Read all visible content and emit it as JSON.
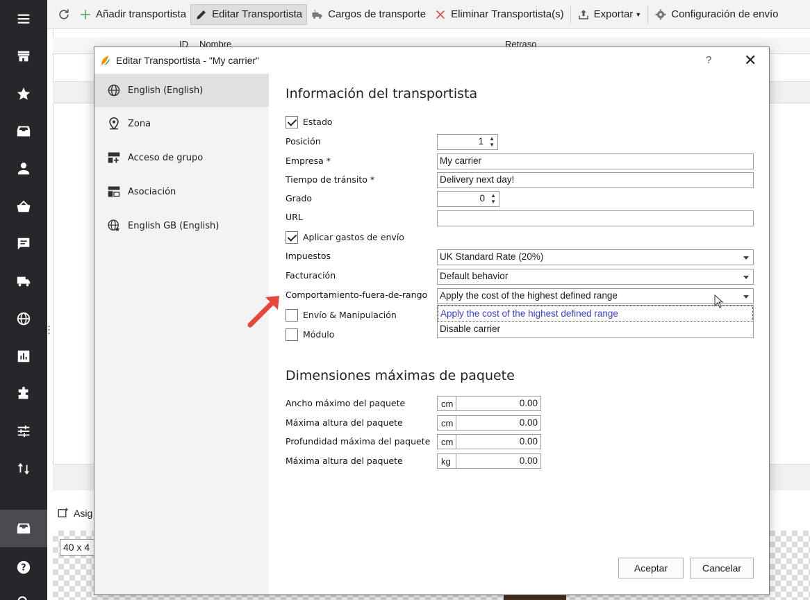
{
  "toolbar": {
    "add": "Añadir transportista",
    "edit": "Editar Transportista",
    "charges": "Cargos de transporte",
    "delete": "Eliminar Transportista(s)",
    "export": "Exportar",
    "config": "Configuración de envío"
  },
  "grid": {
    "col_id": "ID",
    "col_name": "Nombre",
    "col_delay": "Retraso",
    "assign_label": "Asig",
    "size_value": "40 x 4"
  },
  "dialog": {
    "title": "Editar Transportista - \"My carrier\"",
    "help": "?",
    "close": "✕",
    "sidebar": [
      {
        "label": "English (English)",
        "icon": "globe-icon"
      },
      {
        "label": "Zona",
        "icon": "location-pin-icon"
      },
      {
        "label": "Acceso de grupo",
        "icon": "group-add-icon"
      },
      {
        "label": "Asociación",
        "icon": "association-icon"
      },
      {
        "label": "English GB (English)",
        "icon": "globe-star-icon"
      }
    ],
    "section1": "Información del transportista",
    "estado": "Estado",
    "posicion": "Posición",
    "posicion_value": "1",
    "empresa": "Empresa *",
    "empresa_value": "My carrier",
    "transito": "Tiempo de tránsito *",
    "transito_value": "Delivery next day!",
    "grado": "Grado",
    "grado_value": "0",
    "url": "URL",
    "url_value": "",
    "aplicar": "Aplicar gastos de envío",
    "impuestos": "Impuestos",
    "impuestos_value": "UK Standard Rate (20%)",
    "facturacion": "Facturación",
    "facturacion_value": "Default behavior",
    "fuera_rango": "Comportamiento-fuera-de-rango",
    "fuera_rango_value": "Apply the cost of the highest defined range",
    "fuera_rango_options": [
      "Apply the cost of the highest defined range",
      "Disable carrier"
    ],
    "envio": "Envío & Manipulación",
    "modulo": "Módulo",
    "section2": "Dimensiones máximas de paquete",
    "dims": [
      {
        "label": "Ancho máximo del paquete",
        "unit": "cm",
        "value": "0.00"
      },
      {
        "label": "Máxima altura del paquete",
        "unit": "cm",
        "value": "0.00"
      },
      {
        "label": "Profundidad máxima del paquete",
        "unit": "cm",
        "value": "0.00"
      },
      {
        "label": "Máxima altura del paquete",
        "unit": "kg",
        "value": "0.00"
      }
    ],
    "ok": "Aceptar",
    "cancel": "Cancelar"
  },
  "colors": {
    "rail": "#26272b",
    "arrow": "#e8453c",
    "highlight": "#3d3ad6"
  }
}
